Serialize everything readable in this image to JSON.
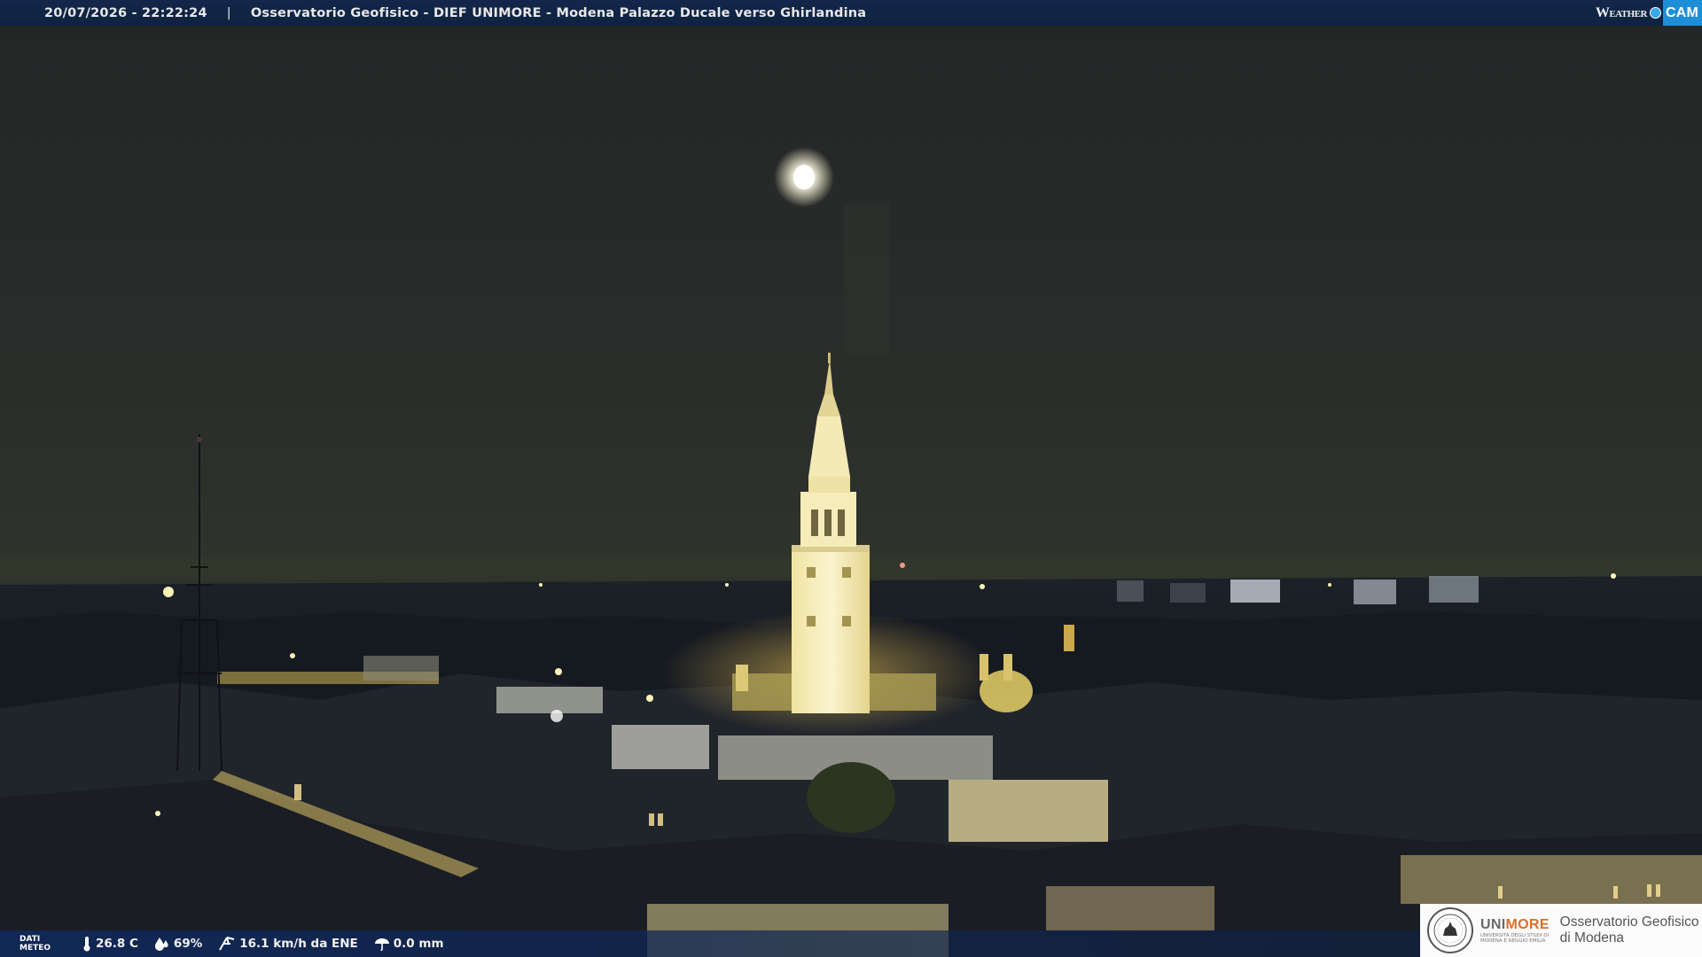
{
  "header": {
    "timestamp": "20/07/2026 - 22:22:24",
    "separator": "|",
    "camera_title": "Osservatorio Geofisico - DIEF UNIMORE - Modena Palazzo Ducale verso Ghirlandina",
    "brand_weather": "Weather",
    "brand_cam": "CAM"
  },
  "meteo": {
    "tag_line1": "DATI",
    "tag_line2": "METEO",
    "temperature": "26.8 C",
    "humidity": "69%",
    "wind": "16.1 km/h da ENE",
    "rain": "0.0 mm",
    "icons": [
      "thermometer-icon",
      "humidity-icon",
      "wind-icon",
      "rain-icon"
    ]
  },
  "footer_logo": {
    "uni_prefix": "UNI",
    "uni_accent": "MORE",
    "uni_sub_line1": "UNIVERSITÀ DEGLI STUDI DI",
    "uni_sub_line2": "MODENA E REGGIO EMILIA",
    "observatory_line1": "Osservatorio Geofisico",
    "observatory_line2": "di Modena"
  },
  "colors": {
    "sky": "#2a2d2a",
    "tower": "#f3eab0",
    "lights": "#ffd86a",
    "bar": "#12274a",
    "accent": "#d9702b"
  }
}
